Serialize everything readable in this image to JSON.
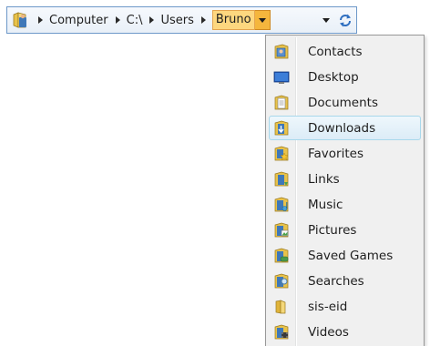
{
  "breadcrumb": {
    "items": [
      {
        "label": "Computer"
      },
      {
        "label": "C:\\"
      },
      {
        "label": "Users"
      },
      {
        "label": "Bruno"
      }
    ],
    "active_index": 3,
    "active_color": "#fdd77f"
  },
  "menu": {
    "highlighted_index": 3,
    "items": [
      {
        "label": "Contacts",
        "icon": "contacts-icon"
      },
      {
        "label": "Desktop",
        "icon": "desktop-icon"
      },
      {
        "label": "Documents",
        "icon": "documents-icon"
      },
      {
        "label": "Downloads",
        "icon": "downloads-icon"
      },
      {
        "label": "Favorites",
        "icon": "favorites-icon"
      },
      {
        "label": "Links",
        "icon": "links-icon"
      },
      {
        "label": "Music",
        "icon": "music-icon"
      },
      {
        "label": "Pictures",
        "icon": "pictures-icon"
      },
      {
        "label": "Saved Games",
        "icon": "saved-games-icon"
      },
      {
        "label": "Searches",
        "icon": "searches-icon"
      },
      {
        "label": "sis-eid",
        "icon": "folder-icon"
      },
      {
        "label": "Videos",
        "icon": "videos-icon"
      }
    ]
  }
}
